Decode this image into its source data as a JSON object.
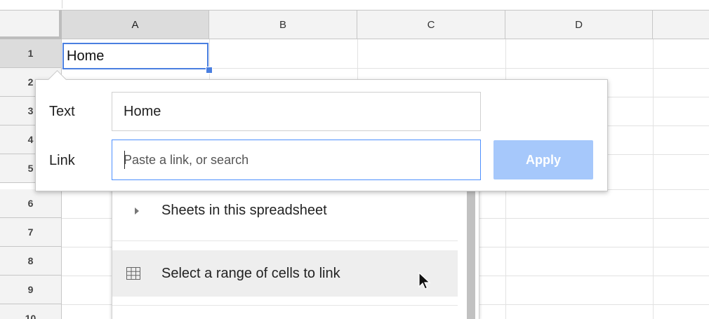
{
  "sheet": {
    "columns": [
      "A",
      "B",
      "C",
      "D"
    ],
    "rows": [
      "1",
      "2",
      "3",
      "4",
      "5",
      "6",
      "7",
      "8",
      "9",
      "10"
    ],
    "active_cell_value": "Home"
  },
  "link_dialog": {
    "text_label": "Text",
    "text_value": "Home",
    "link_label": "Link",
    "link_placeholder": "Paste a link, or search",
    "apply_label": "Apply"
  },
  "link_suggestions": {
    "sheets_label": "Sheets in this spreadsheet",
    "range_label": "Select a range of cells to link"
  },
  "colors": {
    "accent": "#4a7fe0",
    "apply_disabled": "#a6c8fb",
    "header_bg": "#f3f3f3",
    "active_header_bg": "#dcdcdc"
  },
  "icons": {
    "expand": "triangle-right-icon",
    "range": "grid-icon",
    "cursor": "cursor-icon"
  }
}
